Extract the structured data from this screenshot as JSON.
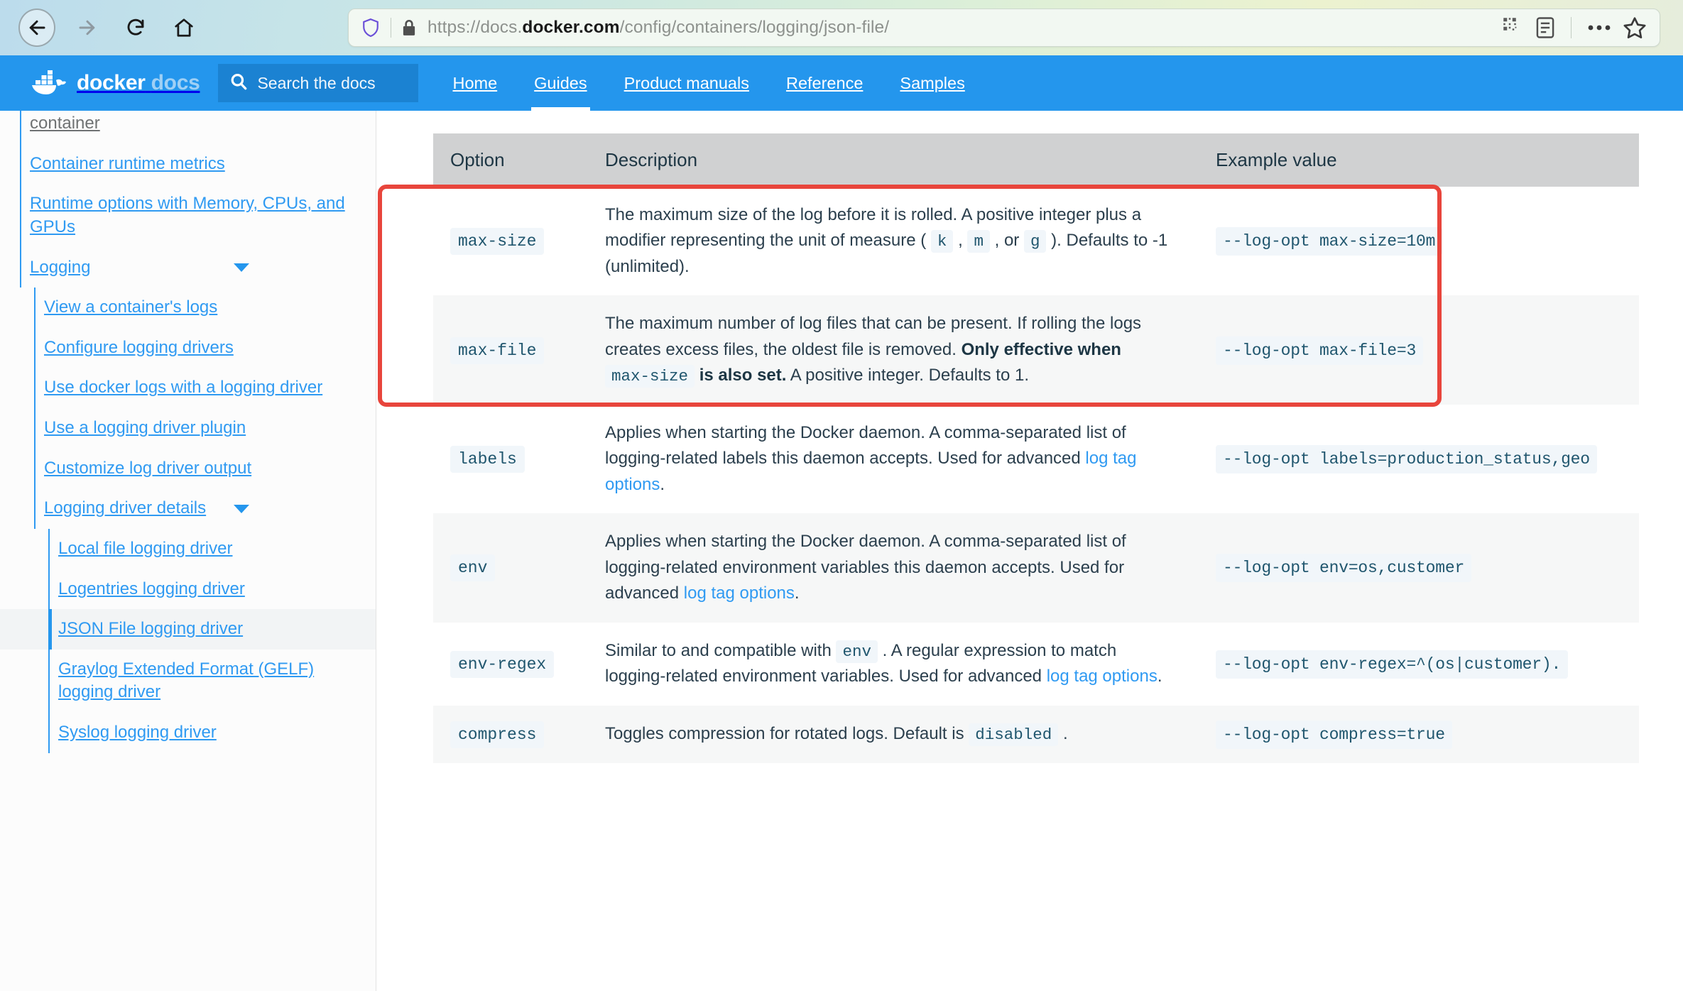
{
  "browser": {
    "back_icon": "arrow-left-icon",
    "forward_icon": "arrow-right-icon",
    "reload_icon": "reload-icon",
    "home_icon": "home-icon",
    "shield_icon": "shield-icon",
    "lock_icon": "lock-icon",
    "url_scheme": "https://docs.",
    "url_domain": "docker.com",
    "url_path": "/config/containers/logging/json-file/",
    "url_full": "https://docs.docker.com/config/containers/logging/json-file/",
    "qr_icon": "qr-code-icon",
    "reader_icon": "reader-mode-icon",
    "menu_icon": "ellipsis-icon",
    "bookmark_icon": "star-icon"
  },
  "header": {
    "brand_primary": "docker",
    "brand_secondary": "docs",
    "logo_icon": "docker-whale-icon",
    "search_icon": "search-icon",
    "search_placeholder": "Search the docs",
    "search_value": "",
    "nav": [
      {
        "label": "Home",
        "active": false
      },
      {
        "label": "Guides",
        "active": true
      },
      {
        "label": "Product manuals",
        "active": false
      },
      {
        "label": "Reference",
        "active": false
      },
      {
        "label": "Samples",
        "active": false
      }
    ],
    "brand_color": "#2496ed",
    "search_bg": "#1b82d2"
  },
  "sidebar": {
    "items": [
      {
        "label": "container",
        "level": 1,
        "muted": true,
        "caret": false,
        "active": false
      },
      {
        "label": "Container runtime metrics",
        "level": 1,
        "muted": false,
        "caret": false,
        "active": false
      },
      {
        "label": "Runtime options with Memory, CPUs, and GPUs",
        "level": 1,
        "muted": false,
        "caret": false,
        "active": false
      },
      {
        "label": "Logging",
        "level": 1,
        "muted": false,
        "caret": true,
        "active": false
      },
      {
        "label": "View a container's logs",
        "level": 2,
        "muted": false,
        "caret": false,
        "active": false
      },
      {
        "label": "Configure logging drivers",
        "level": 2,
        "muted": false,
        "caret": false,
        "active": false
      },
      {
        "label": "Use docker logs with a logging driver",
        "level": 2,
        "muted": false,
        "caret": false,
        "active": false
      },
      {
        "label": "Use a logging driver plugin",
        "level": 2,
        "muted": false,
        "caret": false,
        "active": false
      },
      {
        "label": "Customize log driver output",
        "level": 2,
        "muted": false,
        "caret": false,
        "active": false
      },
      {
        "label": "Logging driver details",
        "level": 2,
        "muted": false,
        "caret": true,
        "active": false
      },
      {
        "label": "Local file logging driver",
        "level": 3,
        "muted": false,
        "caret": false,
        "active": false
      },
      {
        "label": "Logentries logging driver",
        "level": 3,
        "muted": false,
        "caret": false,
        "active": false
      },
      {
        "label": "JSON File logging driver",
        "level": 3,
        "muted": false,
        "caret": false,
        "active": true
      },
      {
        "label": "Graylog Extended Format (GELF) logging driver",
        "level": 3,
        "muted": false,
        "caret": false,
        "active": false
      },
      {
        "label": "Syslog logging driver",
        "level": 3,
        "muted": false,
        "caret": false,
        "active": false
      }
    ],
    "accent_color": "#2f9af2",
    "active_bg": "#f2f4f5"
  },
  "table": {
    "headers": [
      "Option",
      "Description",
      "Example value"
    ],
    "rows": [
      {
        "option": "max-size",
        "description_html": "The maximum size of the log before it is rolled. A positive integer plus a modifier representing the unit of measure ( <code class=\"tok\">k</code> , <code class=\"tok\">m</code> , or <code class=\"tok\">g</code> ). Defaults to -1 (unlimited).",
        "example": "--log-opt max-size=10m",
        "highlighted": true,
        "shade": "odd"
      },
      {
        "option": "max-file",
        "description_html": "The maximum number of log files that can be present. If rolling the logs creates excess files, the oldest file is removed. <b>Only effective when</b> <code class=\"tok\">max-size</code> <b>is also set.</b> A positive integer. Defaults to 1.",
        "example": "--log-opt max-file=3",
        "highlighted": true,
        "shade": "even"
      },
      {
        "option": "labels",
        "description_html": "Applies when starting the Docker daemon. A comma-separated list of logging-related labels this daemon accepts. Used for advanced <a class=\"doclink\" href=\"#\" data-name=\"log-tag-options-link\" data-interactable=\"true\">log tag options</a>.",
        "example": "--log-opt labels=production_status,geo",
        "highlighted": false,
        "shade": "odd"
      },
      {
        "option": "env",
        "description_html": "Applies when starting the Docker daemon. A comma-separated list of logging-related environment variables this daemon accepts. Used for advanced <a class=\"doclink\" href=\"#\" data-name=\"log-tag-options-link\" data-interactable=\"true\">log tag options</a>.",
        "example": "--log-opt env=os,customer",
        "highlighted": false,
        "shade": "even"
      },
      {
        "option": "env-regex",
        "description_html": "Similar to and compatible with <code class=\"tok\">env</code> . A regular expression to match logging-related environment variables. Used for advanced <a class=\"doclink\" href=\"#\" data-name=\"log-tag-options-link\" data-interactable=\"true\">log tag options</a>.",
        "example": "--log-opt env-regex=^(os|customer).",
        "highlighted": false,
        "shade": "odd"
      },
      {
        "option": "compress",
        "description_html": "Toggles compression for rotated logs. Default is <code class=\"tok\">disabled</code> .",
        "example": "--log-opt compress=true",
        "highlighted": false,
        "shade": "even"
      }
    ],
    "header_bg": "#d0d1d2",
    "code_color": "#20566e",
    "code_bg": "#f1f6fa"
  },
  "annotation": {
    "highlight_color": "#e8453c",
    "highlight_rows": [
      "max-size",
      "max-file"
    ]
  }
}
